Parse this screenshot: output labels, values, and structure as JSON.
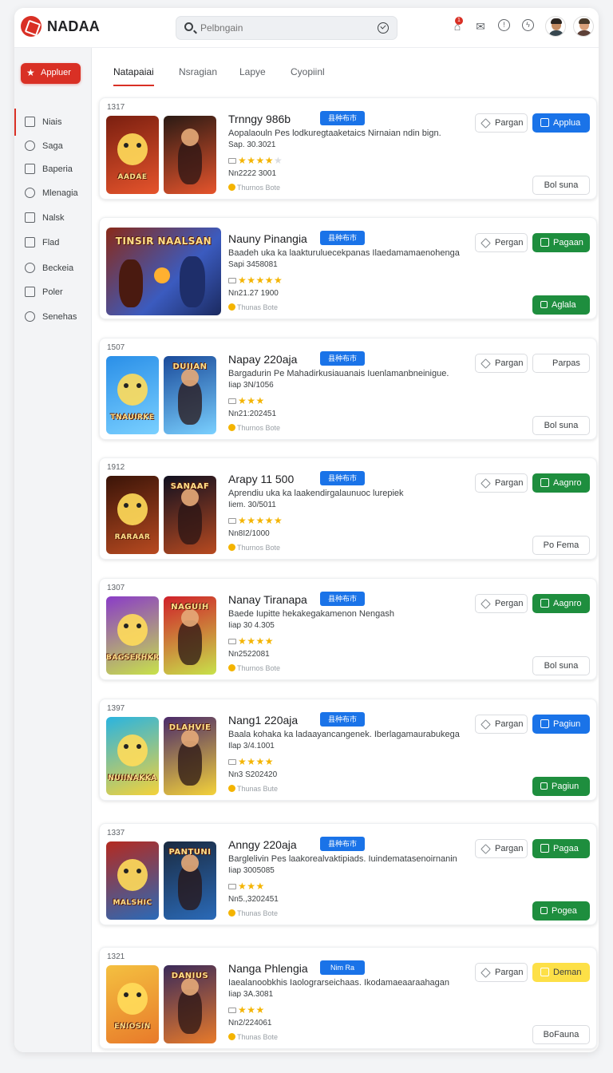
{
  "app": {
    "brand": "NADAA"
  },
  "search": {
    "placeholder": "Pelbngain"
  },
  "header": {
    "notification_count": "1"
  },
  "sidebar": {
    "primary_button": "Appluer",
    "items": [
      {
        "label": "Niais",
        "icon": "edit-icon"
      },
      {
        "label": "Saga",
        "icon": "clock-icon"
      },
      {
        "label": "Baperia",
        "icon": "tag-icon"
      },
      {
        "label": "Mlenagia",
        "icon": "user-icon"
      },
      {
        "label": "Nalsk",
        "icon": "grid-icon"
      },
      {
        "label": "Flad",
        "icon": "square-icon"
      },
      {
        "label": "Beckeia",
        "icon": "cloud-icon"
      },
      {
        "label": "Poler",
        "icon": "doc-icon"
      },
      {
        "label": "Senehas",
        "icon": "circle-icon"
      }
    ]
  },
  "tabs": [
    "Natapaiai",
    "Nsragian",
    "Lapye",
    "Cyopiinl"
  ],
  "cards": [
    {
      "rank": "1317",
      "title": "Trnngy 986b",
      "tag": "县种布市",
      "desc": "Aopalaouln Pes lodkuregtaaketaics Nirnaian ndin bign.",
      "date": "Sap. 30.3021",
      "stars": "★★★★",
      "stars_dim": "★",
      "num": "Nn2222 3001",
      "meta": "Thurnos Bote",
      "art_left": "AADAE",
      "art_right": "",
      "outline_btn": "Pargan",
      "solid_btn": "Applua",
      "solid_color": "#1a73e8",
      "lower_btn": "Bol suna",
      "lower_color": ""
    },
    {
      "rank": "",
      "title": "Nauny Pinangia",
      "tag": "县种布市",
      "desc": "Baadeh uka ka laakturuluecekpanas Ilaedamamaenohengan",
      "date": "Sapi 3458081",
      "stars": "★★★★★",
      "stars_dim": "",
      "num": "Nn21.27 1900",
      "meta": "Thunas Bote",
      "art_left": "TINSIR NAALSAN",
      "art_right": "",
      "outline_btn": "Pergan",
      "solid_btn": "Pagaan",
      "solid_color": "#1e8e3e",
      "lower_btn": "Aglala",
      "lower_color": "green"
    },
    {
      "rank": "1507",
      "title": "Napay 220aja",
      "tag": "县种布市",
      "desc": "Bargadurin Pe Mahadirkusiauanais Iuenlamanbneinigue.",
      "date": "Iiap 3N/1056",
      "stars": "★★★",
      "stars_dim": "",
      "num": "Nn21:202451",
      "meta": "Thurnos Bote",
      "art_left": "TNAUIRKE",
      "art_right": "DUIIAN",
      "outline_btn": "Pargan",
      "solid_btn": "Parpas",
      "solid_color": "",
      "lower_btn": "Bol suna",
      "lower_color": ""
    },
    {
      "rank": "1912",
      "title": "Arapy 11 500",
      "tag": "县种布市",
      "desc": "Aprendiu uka ka laakendirgalaunuoc lurepiek",
      "date": "Iiem. 30/5011",
      "stars": "★★★★★",
      "stars_dim": "",
      "num": "Nn8I2/1000",
      "meta": "Thurnos Bote",
      "art_left": "RARAAR",
      "art_right": "SANAAF",
      "outline_btn": "Pargan",
      "solid_btn": "Aagnro",
      "solid_color": "#1e8e3e",
      "lower_btn": "Po Fema",
      "lower_color": ""
    },
    {
      "rank": "1307",
      "title": "Nanay Tiranapa",
      "tag": "县种布市",
      "desc": "Baede Iupitte hekakegakamenon Nengash",
      "date": "Iiap 30 4.305",
      "stars": "★★★★",
      "stars_dim": "",
      "num": "Nn2522081",
      "meta": "Thurnos Bote",
      "art_left": "BAGSERHKR",
      "art_right": "NAGUIH",
      "outline_btn": "Pergan",
      "solid_btn": "Aagnro",
      "solid_color": "#1e8e3e",
      "lower_btn": "Bol suna",
      "lower_color": ""
    },
    {
      "rank": "1397",
      "title": "Nang1 220aja",
      "tag": "县种布市",
      "desc": "Baala kohaka ka ladaayancangenek. Iberlagamaurabukegan",
      "date": "Ilap 3/4.1001",
      "stars": "★★★★",
      "stars_dim": "",
      "num": "Nn3 S202420",
      "meta": "Thunas Bute",
      "art_left": "NUIINAKKA",
      "art_right": "DLAHVIE",
      "outline_btn": "Pargan",
      "solid_btn": "Pagiun",
      "solid_color": "#1a73e8",
      "lower_btn": "Pagiun",
      "lower_color": "green"
    },
    {
      "rank": "1337",
      "title": "Anngy 220aja",
      "tag": "县种布市",
      "desc": "Barglelivin Pes laakorealvaktipiads. Iuindematasenoirnanin",
      "date": "Iiap 3005085",
      "stars": "★★★",
      "stars_dim": "",
      "num": "Nn5.,3202451",
      "meta": "Thunas Bote",
      "art_left": "MALSHIC",
      "art_right": "PANTUNI",
      "outline_btn": "Pargan",
      "solid_btn": "Pagaa",
      "solid_color": "#1e8e3e",
      "lower_btn": "Pogea",
      "lower_color": "green"
    },
    {
      "rank": "1321",
      "title": "Nanga Phlengia",
      "tag": "Nim Ra",
      "desc": "Iaealanoobkhis Iaolograrseichaas. Ikodamaeaaraahagan",
      "date": "Iiap 3A.3081",
      "stars": "★★★",
      "stars_dim": "",
      "num": "Nn2/224061",
      "meta": "Thunas Bote",
      "art_left": "ENIOSIN",
      "art_right": "DANIUS",
      "outline_btn": "Pargan",
      "solid_btn": "Deman",
      "solid_color": "#fde047",
      "lower_btn": "BoFauna",
      "lower_color": ""
    }
  ]
}
